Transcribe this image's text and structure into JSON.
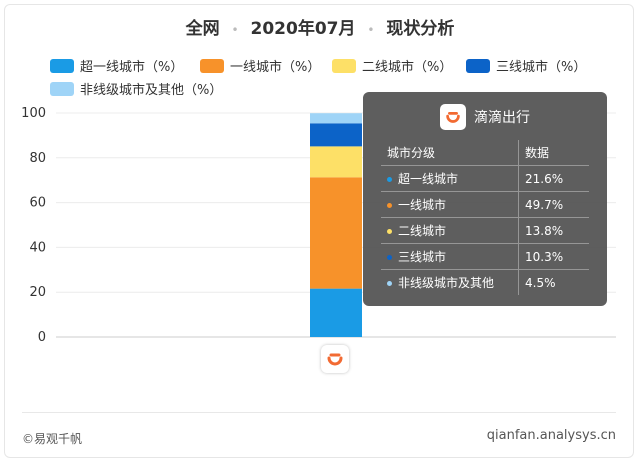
{
  "header": {
    "scope": "全网",
    "period": "2020年07月",
    "topic": "现状分析",
    "separator": "•"
  },
  "chart_data": {
    "type": "bar",
    "stacked": true,
    "categories": [
      "滴滴出行"
    ],
    "ylim": [
      0,
      100
    ],
    "yticks": [
      0,
      20,
      40,
      60,
      80,
      100
    ],
    "grid": true,
    "legend_position": "top",
    "series": [
      {
        "name": "超一线城市（%）",
        "values": [
          21.6
        ],
        "color": "#1a9be5"
      },
      {
        "name": "一线城市（%）",
        "values": [
          49.7
        ],
        "color": "#f7922a"
      },
      {
        "name": "二线城市（%）",
        "values": [
          13.8
        ],
        "color": "#fde067"
      },
      {
        "name": "三线城市（%）",
        "values": [
          10.3
        ],
        "color": "#0c63c8"
      },
      {
        "name": "非线级城市及其他（%）",
        "values": [
          4.5
        ],
        "color": "#9fd4f7"
      }
    ]
  },
  "tooltip": {
    "app_name": "滴滴出行",
    "col_header_1": "城市分级",
    "col_header_2": "数据",
    "rows": [
      {
        "label": "超一线城市",
        "value": "21.6%",
        "color": "#1a9be5"
      },
      {
        "label": "一线城市",
        "value": "49.7%",
        "color": "#f7922a"
      },
      {
        "label": "二线城市",
        "value": "13.8%",
        "color": "#fde067"
      },
      {
        "label": "三线城市",
        "value": "10.3%",
        "color": "#0c63c8"
      },
      {
        "label": "非线级城市及其他",
        "value": "4.5%",
        "color": "#9fd4f7"
      }
    ]
  },
  "footer": {
    "source": "©易观千帆",
    "url": "qianfan.analysys.cn"
  },
  "icons": {
    "app_logo": "didi-logo-icon"
  }
}
